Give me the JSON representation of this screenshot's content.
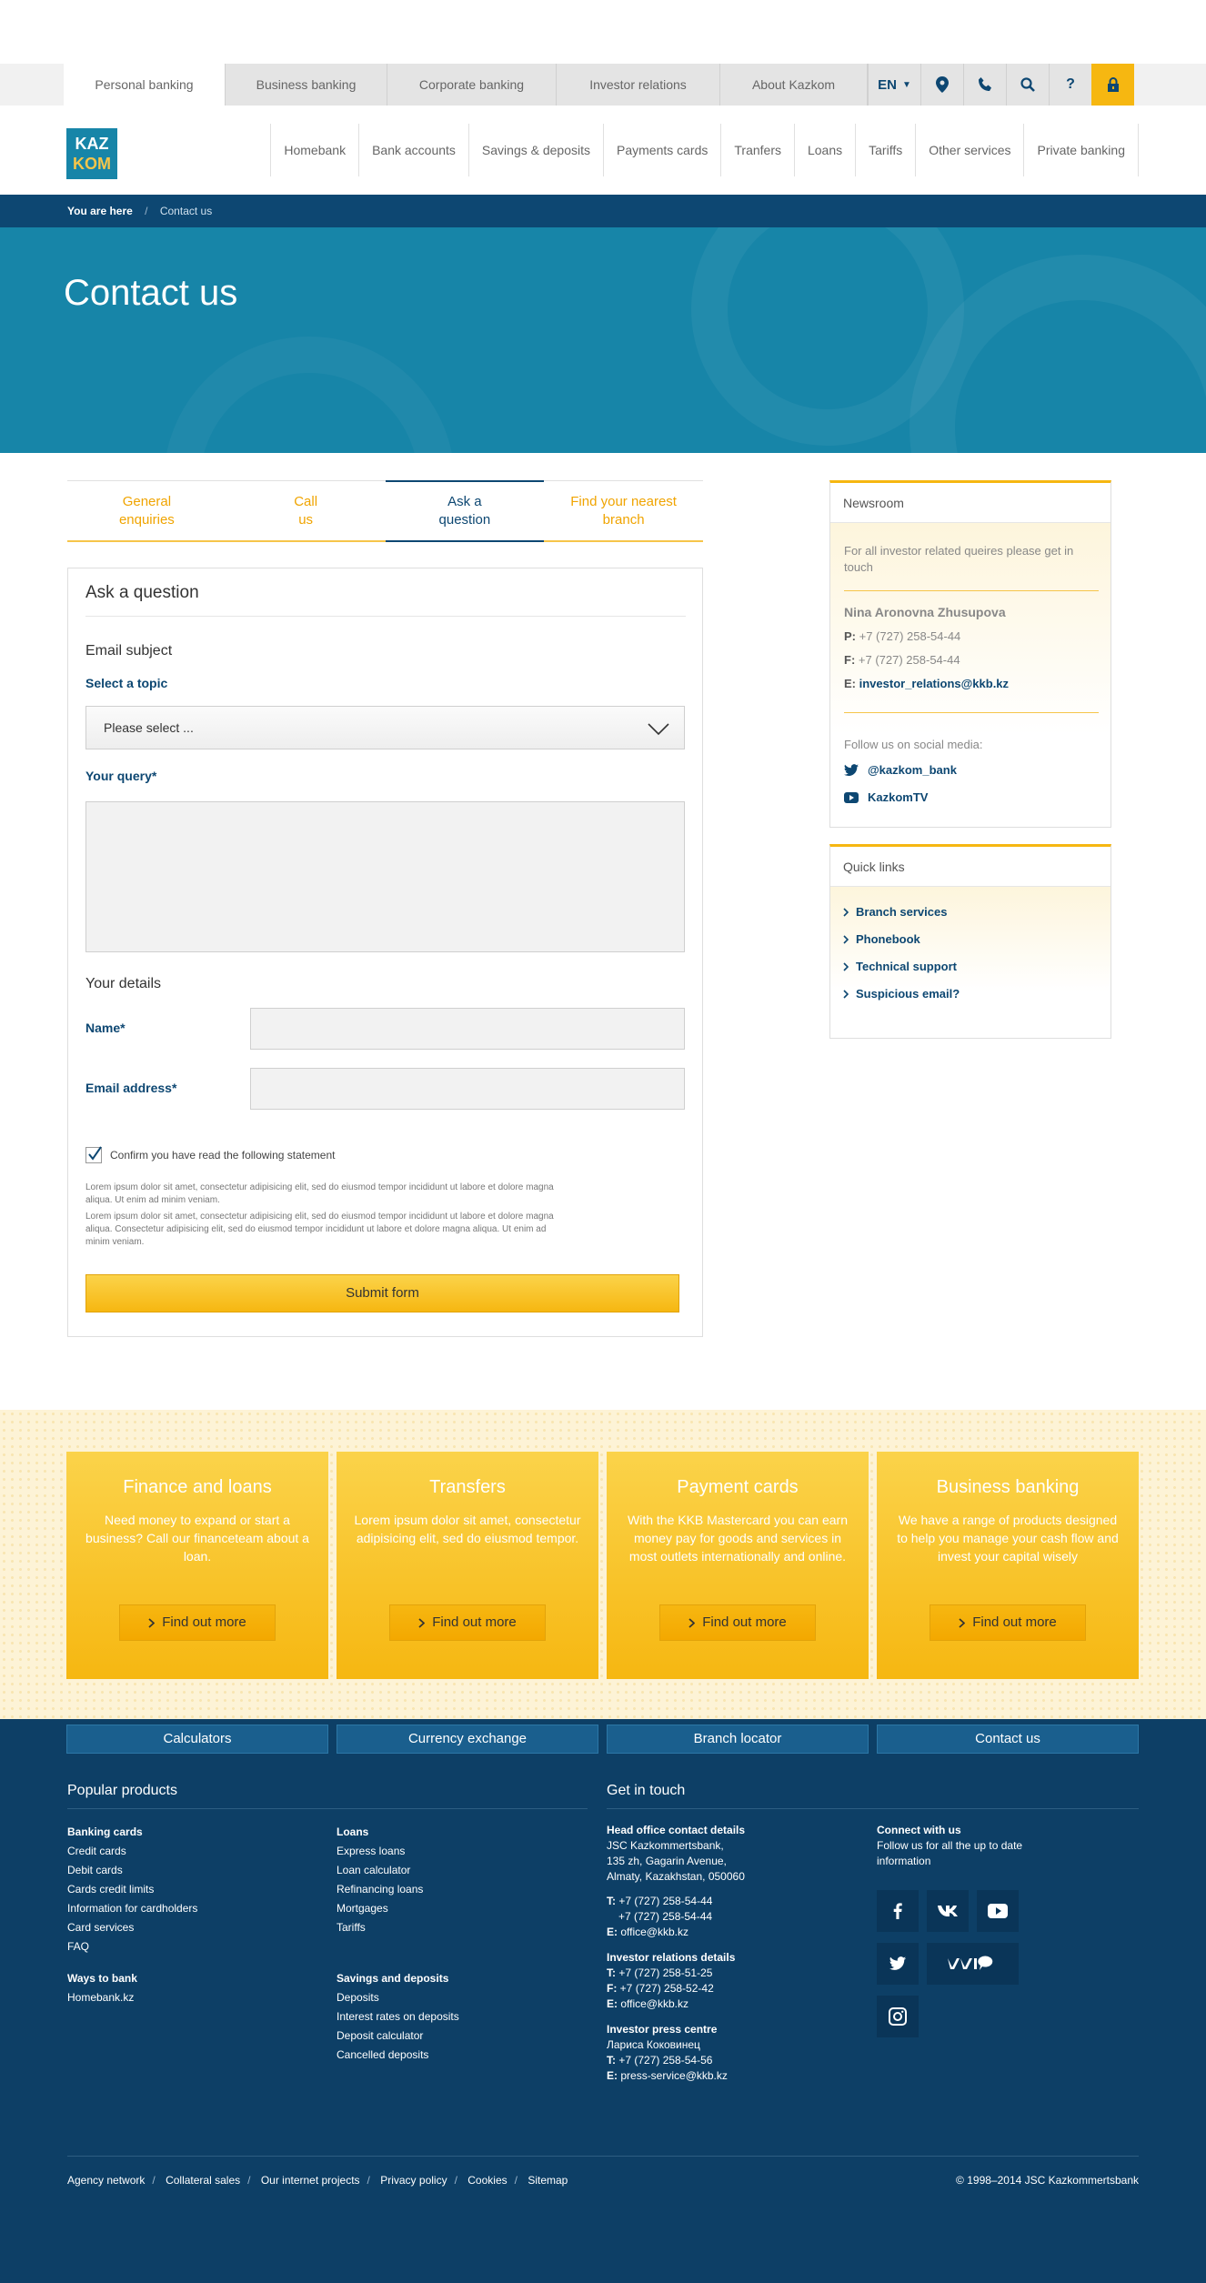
{
  "topnav": {
    "tabs": [
      "Personal banking",
      "Business banking",
      "Corporate banking",
      "Investor relations",
      "About Kazkom"
    ],
    "lang": "EN"
  },
  "logo": {
    "line1": "KAZ",
    "line2": "KOM"
  },
  "mainnav": [
    "Homebank",
    "Bank accounts",
    "Savings & deposits",
    "Payments cards",
    "Tranfers",
    "Loans",
    "Tariffs",
    "Other services",
    "Private banking"
  ],
  "breadcrumb": {
    "label": "You are here",
    "sep": "/",
    "current": "Contact us"
  },
  "hero": {
    "title": "Contact us"
  },
  "tabs": [
    {
      "line1": "General",
      "line2": "enquiries"
    },
    {
      "line1": "Call",
      "line2": "us"
    },
    {
      "line1": "Ask a",
      "line2": "question"
    },
    {
      "line1": "Find your nearest",
      "line2": "branch"
    }
  ],
  "form": {
    "title": "Ask a question",
    "email_subject": "Email subject",
    "topic_label": "Select a topic",
    "topic_value": "Please select ...",
    "query_label": "Your query*",
    "details_title": "Your details",
    "name_label": "Name*",
    "email_label": "Email address*",
    "confirm_label": "Confirm you have read the following statement",
    "lorem1": "Lorem ipsum dolor sit amet, consectetur adipisicing elit, sed do eiusmod tempor incididunt ut labore et dolore magna aliqua. Ut enim ad minim veniam.",
    "lorem2": "Lorem ipsum dolor sit amet, consectetur adipisicing elit, sed do eiusmod tempor incididunt ut labore et dolore magna aliqua. Consectetur adipisicing elit, sed do eiusmod tempor incididunt ut labore et dolore magna aliqua. Ut enim ad minim veniam.",
    "submit": "Submit form"
  },
  "newsroom": {
    "title": "Newsroom",
    "intro": "For all investor related queires please get in touch",
    "name": "Nina Aronovna Zhusupova",
    "p_label": "P:",
    "phone": "+7 (727) 258-54-44",
    "f_label": "F:",
    "fax": "+7 (727) 258-54-44",
    "e_label": "E:",
    "email": "investor_relations@kkb.kz",
    "follow": "Follow us on social media:",
    "twitter": "@kazkom_bank",
    "youtube": "KazkomTV"
  },
  "quicklinks": {
    "title": "Quick links",
    "items": [
      "Branch services",
      "Phonebook",
      "Technical support",
      "Suspicious email?"
    ]
  },
  "promos": [
    {
      "title": "Finance and loans",
      "text": "Need money to expand or start a business? Call our financeteam about a loan.",
      "btn": "Find out more"
    },
    {
      "title": "Transfers",
      "text": "Lorem ipsum dolor sit amet, consectetur adipisicing elit, sed do eiusmod tempor.",
      "btn": "Find out more"
    },
    {
      "title": "Payment cards",
      "text": "With the KKB Mastercard you can earn money pay for goods and services in most outlets internationally and online.",
      "btn": "Find out more"
    },
    {
      "title": "Business banking",
      "text": "We have a range of products designed to help you manage your cash flow and invest your capital wisely",
      "btn": "Find out more"
    }
  ],
  "footer": {
    "quick": [
      "Calculators",
      "Currency exchange",
      "Branch locator",
      "Contact us"
    ],
    "popular_title": "Popular products",
    "touch_title": "Get in touch",
    "banking_cards": {
      "title": "Banking cards",
      "items": [
        "Credit cards",
        "Debit cards",
        "Cards credit limits",
        "Information for cardholders",
        "Card services",
        "FAQ"
      ]
    },
    "ways": {
      "title": "Ways to bank",
      "items": [
        "Homebank.kz"
      ]
    },
    "loans": {
      "title": "Loans",
      "items": [
        "Express loans",
        "Loan calculator",
        "Refinancing loans",
        "Mortgages",
        "Tariffs"
      ]
    },
    "savings": {
      "title": "Savings and deposits",
      "items": [
        "Deposits",
        "Interest rates on deposits",
        "Deposit calculator",
        "Cancelled deposits"
      ]
    },
    "head_office": {
      "title": "Head office contact details",
      "lines": [
        "JSC Kazkommertsbank,",
        "135 zh, Gagarin Avenue,",
        "Almaty, Kazakhstan, 050060"
      ],
      "t": "+7 (727) 258-54-44",
      "t2": "+7 (727) 258-54-44",
      "e": "office@kkb.kz"
    },
    "investor": {
      "title": "Investor relations details",
      "t": "+7 (727) 258-51-25",
      "f": "+7 (727) 258-52-42",
      "e": "office@kkb.kz"
    },
    "press": {
      "title": "Investor press centre",
      "name": "Лариса Коковинец",
      "t": "+7 (727) 258-54-56",
      "e": "press-service@kkb.kz"
    },
    "labels": {
      "t": "T:",
      "f": "F:",
      "e": "E:"
    },
    "connect": {
      "title": "Connect with us",
      "text": "Follow us for all the up to date information"
    },
    "bottom_links": [
      "Agency network",
      "Collateral sales",
      "Our internet projects",
      "Privacy policy",
      "Cookies",
      "Sitemap"
    ],
    "copyright": "© 1998–2014 JSC Kazkommertsbank"
  },
  "colors": {
    "navy": "#0d4772",
    "teal": "#1785a8",
    "yellow": "#f6b711"
  }
}
